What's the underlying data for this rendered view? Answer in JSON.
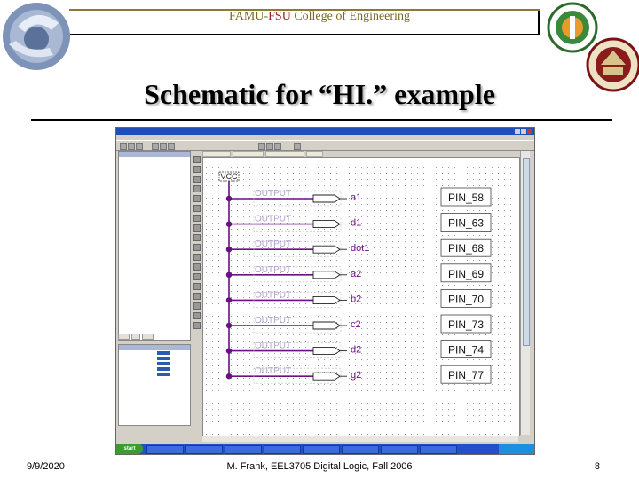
{
  "header": {
    "famu": "FAMU-",
    "fsu": "FSU",
    "college": " College of Engineering"
  },
  "title": "Schematic for “HI.” example",
  "screenshot": {
    "schematic": {
      "vcc_label": "VCC",
      "output_label": "OUTPUT",
      "rows": [
        {
          "signal": "a1",
          "pin": "PIN_58"
        },
        {
          "signal": "d1",
          "pin": "PIN_63"
        },
        {
          "signal": "dot1",
          "pin": "PIN_68"
        },
        {
          "signal": "a2",
          "pin": "PIN_69"
        },
        {
          "signal": "b2",
          "pin": "PIN_70"
        },
        {
          "signal": "c2",
          "pin": "PIN_73"
        },
        {
          "signal": "d2",
          "pin": "PIN_74"
        },
        {
          "signal": "g2",
          "pin": "PIN_77"
        }
      ]
    },
    "start_label": "start"
  },
  "footer": {
    "date": "9/9/2020",
    "course": "M. Frank, EEL3705 Digital Logic, Fall 2006",
    "page": "8"
  },
  "colors": {
    "header_gold": "#7a6a20",
    "fsu_red": "#a02020",
    "signal_purple": "#6a0f84",
    "output_label": "#b5a1d4"
  }
}
